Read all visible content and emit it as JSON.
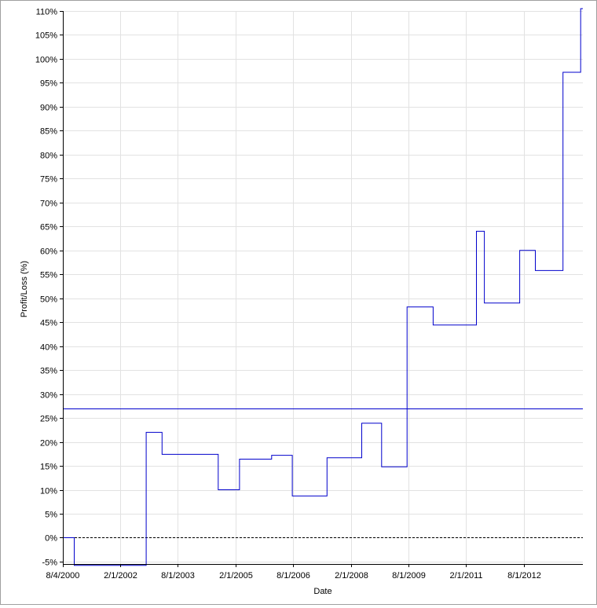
{
  "chart_data": {
    "type": "line",
    "style": "step",
    "title": "",
    "xlabel": "Date",
    "ylabel": "Profit/Loss (%)",
    "ylim": [
      -5.5,
      110
    ],
    "xlim": [
      "2000-08-04",
      "2014-02-15"
    ],
    "grid": true,
    "legend": "none",
    "x_ticks": [
      "8/4/2000",
      "2/1/2002",
      "8/1/2003",
      "2/1/2005",
      "8/1/2006",
      "2/1/2008",
      "8/1/2009",
      "2/1/2011",
      "8/1/2012"
    ],
    "y_ticks": [
      "-5%",
      "0%",
      "5%",
      "10%",
      "15%",
      "20%",
      "25%",
      "30%",
      "35%",
      "40%",
      "45%",
      "50%",
      "55%",
      "60%",
      "65%",
      "70%",
      "75%",
      "80%",
      "85%",
      "90%",
      "95%",
      "100%",
      "105%",
      "110%"
    ],
    "y_tick_values": [
      -5,
      0,
      5,
      10,
      15,
      20,
      25,
      30,
      35,
      40,
      45,
      50,
      55,
      60,
      65,
      70,
      75,
      80,
      85,
      90,
      95,
      100,
      105,
      110
    ],
    "series": [
      {
        "color": "#0000cc",
        "points": [
          {
            "x": "2000-08-04",
            "y": 0
          },
          {
            "x": "2000-11-20",
            "y": -5.8
          },
          {
            "x": "2002-10-05",
            "y": 22
          },
          {
            "x": "2003-03-05",
            "y": 17.4
          },
          {
            "x": "2004-08-20",
            "y": 10
          },
          {
            "x": "2005-03-10",
            "y": 16.4
          },
          {
            "x": "2006-01-10",
            "y": 17.2
          },
          {
            "x": "2006-07-25",
            "y": 8.7
          },
          {
            "x": "2007-06-20",
            "y": 16.7
          },
          {
            "x": "2008-05-15",
            "y": 23.9
          },
          {
            "x": "2008-11-20",
            "y": 14.8
          },
          {
            "x": "2009-07-20",
            "y": 48.2
          },
          {
            "x": "2010-03-25",
            "y": 44.4
          },
          {
            "x": "2011-05-10",
            "y": 64
          },
          {
            "x": "2011-07-25",
            "y": 49
          },
          {
            "x": "2012-06-25",
            "y": 60
          },
          {
            "x": "2012-11-20",
            "y": 55.8
          },
          {
            "x": "2013-08-10",
            "y": 97.2
          },
          {
            "x": "2014-01-25",
            "y": 110.5
          }
        ],
        "end_x": "2014-02-15"
      }
    ],
    "reference_lines": [
      {
        "y": 27,
        "style": "solid",
        "color": "#0000cc"
      },
      {
        "y": 0,
        "style": "dashed",
        "color": "#000000"
      }
    ]
  }
}
